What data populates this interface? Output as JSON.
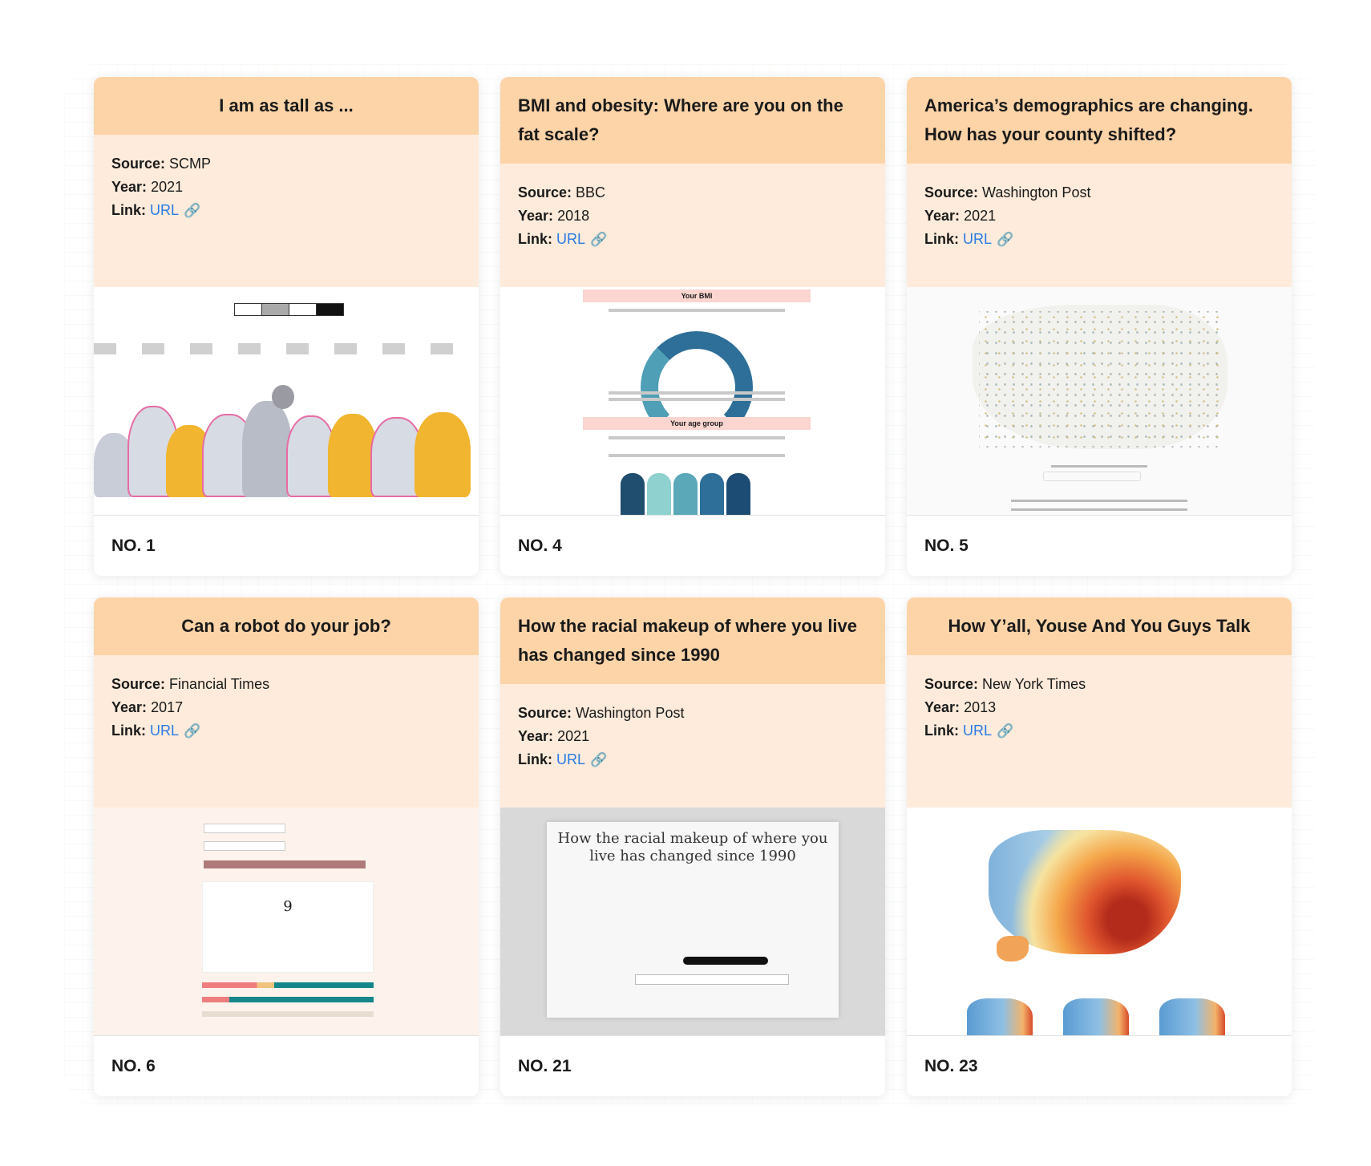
{
  "labels": {
    "source": "Source:",
    "year": "Year:",
    "link": "Link:"
  },
  "cards": [
    {
      "title": "I am as tall as ...",
      "source": "SCMP",
      "year": "2021",
      "link_text": "URL",
      "number": "NO. 1"
    },
    {
      "title": "BMI and obesity: Where are you on the fat scale?",
      "source": "BBC",
      "year": "2018",
      "link_text": "URL",
      "number": "NO. 4"
    },
    {
      "title": "America’s demographics are changing. How has your county shifted?",
      "source": "Washington Post",
      "year": "2021",
      "link_text": "URL",
      "number": "NO. 5"
    },
    {
      "title": "Can a robot do your job?",
      "source": "Financial Times",
      "year": "2017",
      "link_text": "URL",
      "number": "NO. 6"
    },
    {
      "title": "How the racial makeup of where you live has changed since 1990",
      "source": "Washington Post",
      "year": "2021",
      "link_text": "URL",
      "number": "NO. 21"
    },
    {
      "title": "How Y’all, Youse And You Guys Talk",
      "source": "New York Times",
      "year": "2013",
      "link_text": "URL",
      "number": "NO. 23"
    }
  ],
  "thumb_text": {
    "bmi_header": "Your BMI",
    "bmi_age": "Your age group",
    "robot_number": "9",
    "racial_title": "How the racial makeup of where you live has changed since 1990"
  },
  "colors": {
    "title_bg": "#fdd3a8",
    "meta_bg": "#feebdb",
    "link": "#2a7ae4"
  },
  "icons": {
    "link": "link-icon"
  }
}
